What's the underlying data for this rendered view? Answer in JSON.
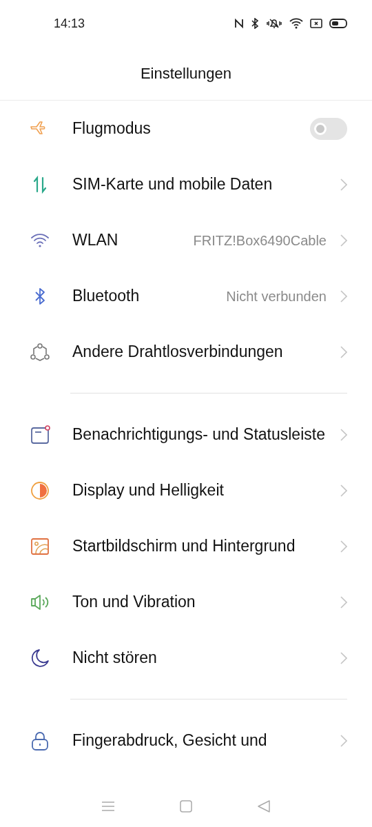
{
  "status_bar": {
    "time": "14:13"
  },
  "title": "Einstellungen",
  "sections": [
    {
      "items": [
        {
          "kind": "toggle",
          "label": "Flugmodus",
          "on": false
        },
        {
          "kind": "link",
          "label": "SIM-Karte und mobile Daten"
        },
        {
          "kind": "link",
          "label": "WLAN",
          "value": "FRITZ!Box6490Cable"
        },
        {
          "kind": "link",
          "label": "Bluetooth",
          "value": "Nicht verbunden"
        },
        {
          "kind": "link",
          "label": "Andere Drahtlosverbindungen"
        }
      ]
    },
    {
      "items": [
        {
          "kind": "link",
          "label": "Benachrichtigungs- und Statusleiste"
        },
        {
          "kind": "link",
          "label": "Display und Helligkeit"
        },
        {
          "kind": "link",
          "label": "Startbildschirm und Hintergrund"
        },
        {
          "kind": "link",
          "label": "Ton und Vibration"
        },
        {
          "kind": "link",
          "label": "Nicht stören"
        }
      ]
    },
    {
      "items": [
        {
          "kind": "link",
          "label": "Fingerabdruck, Gesicht und"
        }
      ]
    }
  ]
}
